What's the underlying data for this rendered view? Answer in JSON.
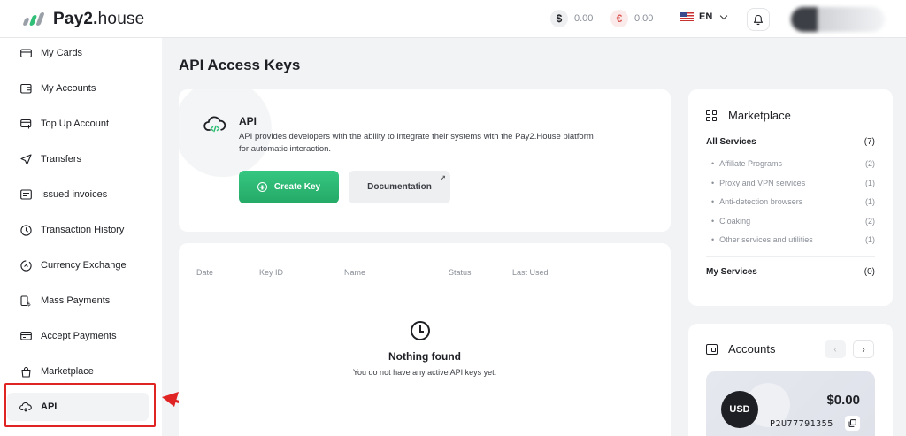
{
  "brand": {
    "name_bold": "Pay2.",
    "name_regular": "house"
  },
  "header": {
    "balances": [
      {
        "symbol": "$",
        "amount": "0.00"
      },
      {
        "symbol": "€",
        "amount": "0.00"
      }
    ],
    "language": "EN"
  },
  "sidebar": {
    "items": [
      {
        "label": "My Cards",
        "icon": "card-icon"
      },
      {
        "label": "My Accounts",
        "icon": "wallet-icon"
      },
      {
        "label": "Top Up Account",
        "icon": "card-add-icon"
      },
      {
        "label": "Transfers",
        "icon": "send-icon"
      },
      {
        "label": "Issued invoices",
        "icon": "invoice-icon"
      },
      {
        "label": "Transaction History",
        "icon": "clock-icon"
      },
      {
        "label": "Currency Exchange",
        "icon": "exchange-icon"
      },
      {
        "label": "Mass Payments",
        "icon": "mass-payments-icon"
      },
      {
        "label": "Accept Payments",
        "icon": "accept-payments-icon"
      },
      {
        "label": "Marketplace",
        "icon": "bag-icon"
      },
      {
        "label": "API",
        "icon": "cloud-icon",
        "active": true
      }
    ]
  },
  "page": {
    "title": "API Access Keys"
  },
  "api": {
    "title": "API",
    "description": "API provides developers with the ability to integrate their systems with the Pay2.House platform for automatic interaction.",
    "create_label": "Create Key",
    "docs_label": "Documentation",
    "docs_ext": "↗"
  },
  "keys_table": {
    "headers": [
      "Date",
      "Key ID",
      "Name",
      "Status",
      "Last Used"
    ],
    "empty_title": "Nothing found",
    "empty_text": "You do not have any active API keys yet."
  },
  "marketplace": {
    "title": "Marketplace",
    "all_label": "All Services",
    "all_count": "(7)",
    "categories": [
      {
        "label": "Affiliate Programs",
        "count": "(2)"
      },
      {
        "label": "Proxy and VPN services",
        "count": "(1)"
      },
      {
        "label": "Anti-detection browsers",
        "count": "(1)"
      },
      {
        "label": "Cloaking",
        "count": "(2)"
      },
      {
        "label": "Other services and utilities",
        "count": "(1)"
      }
    ],
    "my_label": "My Services",
    "my_count": "(0)"
  },
  "accounts": {
    "title": "Accounts",
    "prev": "‹",
    "next": "›",
    "currency": "USD",
    "amount": "$0.00",
    "number": "P2U77791355"
  },
  "colors": {
    "accent": "#2fbf76",
    "highlight": "#e02424"
  }
}
